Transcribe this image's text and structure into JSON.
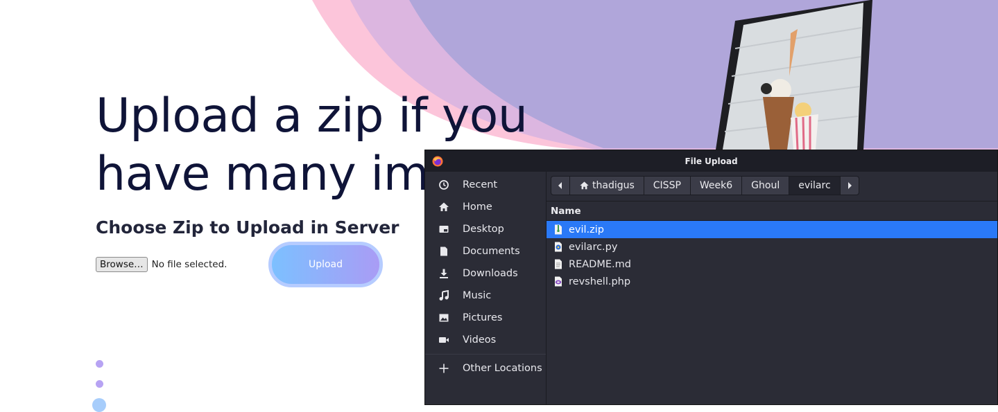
{
  "page": {
    "hero_title": "Upload a zip if you have many images.",
    "subtitle": "Choose Zip to Upload in Server",
    "browse_label": "Browse…",
    "file_status": "No file selected.",
    "upload_label": "Upload"
  },
  "dialog": {
    "title": "File Upload",
    "sidebar": [
      {
        "label": "Recent",
        "icon": "clock-icon"
      },
      {
        "label": "Home",
        "icon": "home-icon"
      },
      {
        "label": "Desktop",
        "icon": "desktop-icon"
      },
      {
        "label": "Documents",
        "icon": "document-icon"
      },
      {
        "label": "Downloads",
        "icon": "download-icon"
      },
      {
        "label": "Music",
        "icon": "music-icon"
      },
      {
        "label": "Pictures",
        "icon": "picture-icon"
      },
      {
        "label": "Videos",
        "icon": "video-icon"
      },
      {
        "label": "Other Locations",
        "icon": "plus-icon"
      }
    ],
    "path": [
      "thadigus",
      "CISSP",
      "Week6",
      "Ghoul",
      "evilarc"
    ],
    "column_header": "Name",
    "files": [
      {
        "name": "evil.zip",
        "icon": "zip-file-icon",
        "selected": true
      },
      {
        "name": "evilarc.py",
        "icon": "python-file-icon",
        "selected": false
      },
      {
        "name": "README.md",
        "icon": "text-file-icon",
        "selected": false
      },
      {
        "name": "revshell.php",
        "icon": "php-file-icon",
        "selected": false
      }
    ]
  },
  "colors": {
    "selection": "#2a79f7",
    "dialog_bg": "#2b2c36",
    "hero_text": "#0f1438",
    "upload_gradient_start": "#7cc0ff",
    "upload_gradient_end": "#a99cf5"
  }
}
